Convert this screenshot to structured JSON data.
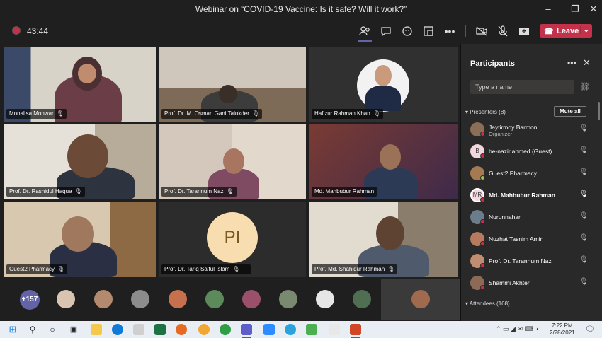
{
  "window": {
    "title": "Webinar on “COVID-19 Vaccine: Is it safe? Will it work?”"
  },
  "toolbar": {
    "timer": "43:44",
    "leave_label": "Leave"
  },
  "grid": {
    "tiles": [
      {
        "name": "Monalisa Monwar"
      },
      {
        "name": "Prof. Dr. M. Osman Gani Talukder"
      },
      {
        "name": "Hafizur Rahman Khan"
      },
      {
        "name": "Prof. Dr. Rashidul Haque"
      },
      {
        "name": "Prof. Dr. Tarannum Naz"
      },
      {
        "name": "Md. Mahbubur Rahman"
      },
      {
        "name": "Guest2 Pharmacy"
      },
      {
        "name": "Prof. Dr. Tariq Saiful Islam",
        "initials": "PI"
      },
      {
        "name": "Prof. Md. Shahidur Rahman"
      }
    ]
  },
  "bottom_row": {
    "overflow_count": "+157"
  },
  "panel": {
    "title": "Participants",
    "search_placeholder": "Type a name",
    "presenters_label": "Presenters (8)",
    "mute_all_label": "Mute all",
    "attendees_label": "Attendees (168)",
    "participants": [
      {
        "name": "Jaytirmoy Barmon",
        "role": "Organizer",
        "avatar": "photo"
      },
      {
        "name": "be-nazir.ahmed (Guest)",
        "avatar": "B"
      },
      {
        "name": "Guest2 Pharmacy",
        "avatar": "photo"
      },
      {
        "name": "Md. Mahbubur Rahman",
        "avatar": "MR",
        "speaking": true
      },
      {
        "name": "Nurunnahar",
        "avatar": "photo"
      },
      {
        "name": "Nuzhat Tasnim Amin",
        "avatar": "photo"
      },
      {
        "name": "Prof. Dr. Tarannum Naz",
        "avatar": "photo"
      },
      {
        "name": "Shammi Akhter",
        "avatar": "photo"
      }
    ]
  },
  "taskbar": {
    "time": "7:22 PM",
    "date": "2/28/2021"
  },
  "colors": {
    "accent": "#6264a7",
    "leave": "#c4314b",
    "panel_bg": "#292929"
  }
}
